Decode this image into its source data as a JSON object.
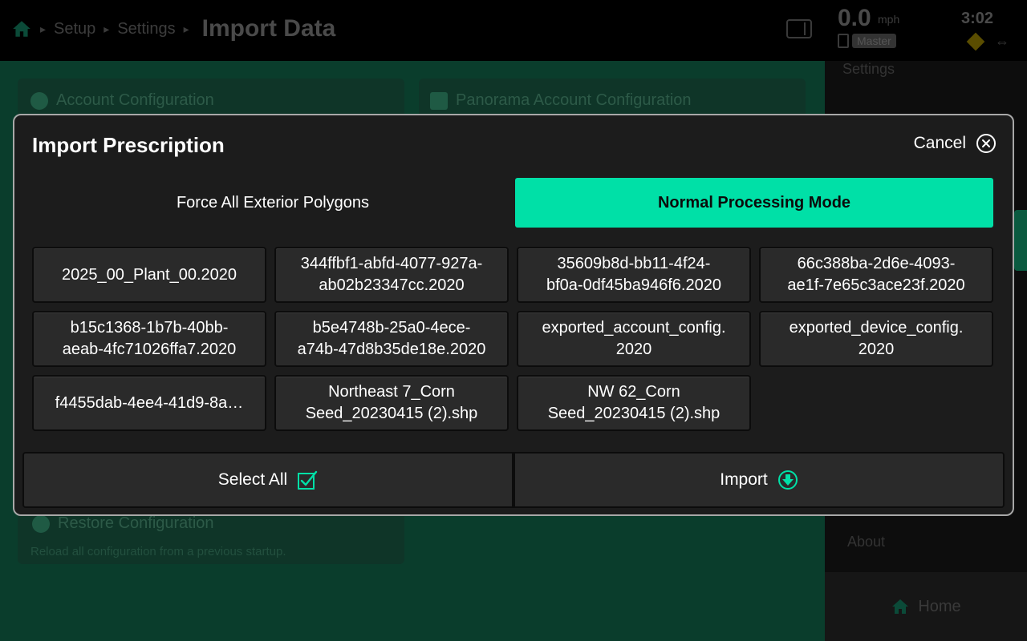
{
  "header": {
    "breadcrumbs": [
      "Setup",
      "Settings"
    ],
    "title": "Import Data",
    "speed": "0.0",
    "speed_unit": "mph",
    "master_label": "Master",
    "time": "3:02",
    "icons": [
      "home-icon",
      "panel-toggle-icon",
      "master-switch-icon",
      "warning-icon",
      "arrows-icon"
    ]
  },
  "background": {
    "cards": {
      "account_config": "Account Configuration",
      "panorama_config": "Panorama Account Configuration",
      "restore_config": "Restore Configuration",
      "restore_sub": "Reload all configuration from a previous startup."
    },
    "sidebar": {
      "settings": "Settings",
      "about": "About",
      "home": "Home"
    }
  },
  "modal": {
    "title": "Import Prescription",
    "cancel_label": "Cancel",
    "modes": {
      "force": "Force All Exterior Polygons",
      "normal": "Normal Processing Mode",
      "selected": "normal"
    },
    "files": [
      [
        "2025_00_Plant_00.2020"
      ],
      [
        "344ffbf1-abfd-4077-927a-",
        "ab02b23347cc.2020"
      ],
      [
        "35609b8d-bb11-4f24-",
        "bf0a-0df45ba946f6.2020"
      ],
      [
        "66c388ba-2d6e-4093-",
        "ae1f-7e65c3ace23f.2020"
      ],
      [
        "b15c1368-1b7b-40bb-",
        "aeab-4fc71026ffa7.2020"
      ],
      [
        "b5e4748b-25a0-4ece-",
        "a74b-47d8b35de18e.2020"
      ],
      [
        "exported_account_config.",
        "2020"
      ],
      [
        "exported_device_config.",
        "2020"
      ],
      [
        "f4455dab-4ee4-41d9-8a…"
      ],
      [
        "Northeast 7_Corn",
        "Seed_20230415 (2).shp"
      ],
      [
        "NW 62_Corn",
        "Seed_20230415 (2).shp"
      ]
    ],
    "select_all_label": "Select All",
    "import_label": "Import"
  },
  "colors": {
    "accent": "#00e0a7",
    "modal_bg": "#1c1c1c",
    "tile_bg": "#2a2a2a",
    "modal_border": "#a8a8a8"
  }
}
